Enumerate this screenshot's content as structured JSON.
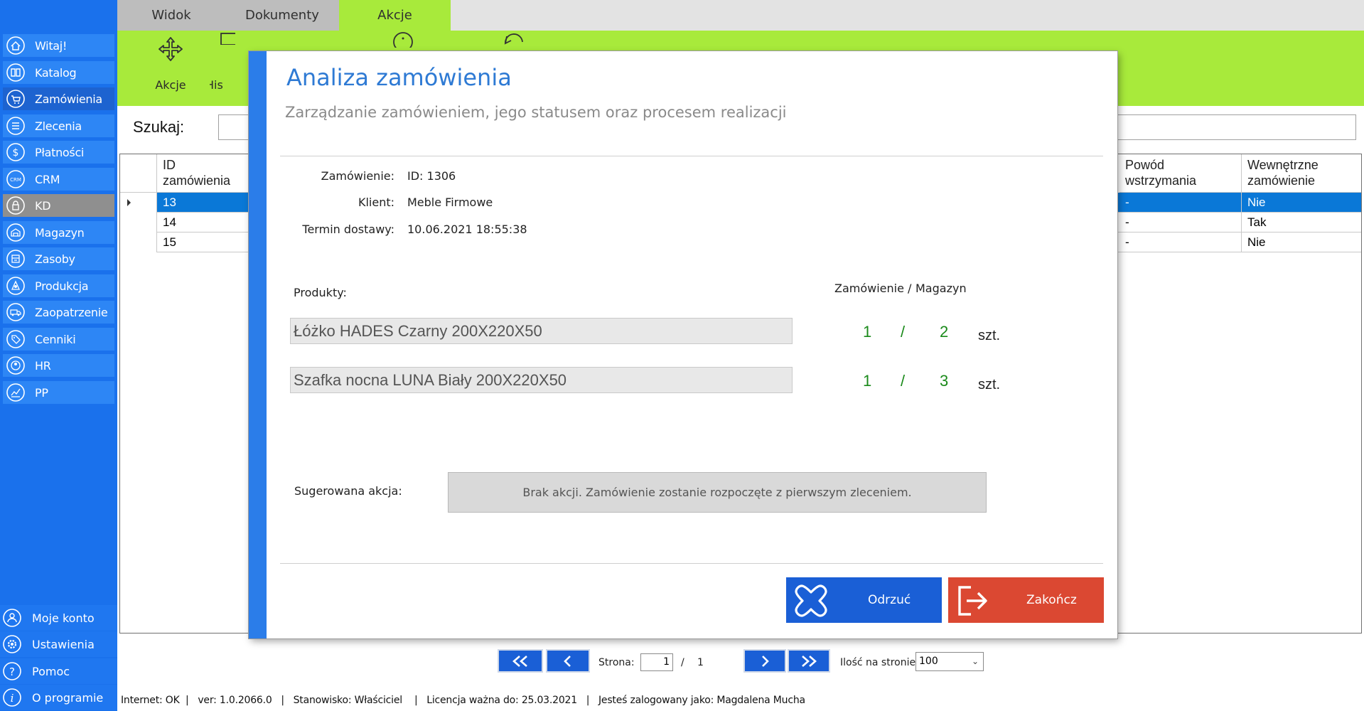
{
  "sidebar": {
    "items": [
      {
        "label": "Witaj!",
        "icon": "home-icon"
      },
      {
        "label": "Katalog",
        "icon": "book-icon"
      },
      {
        "label": "Zamówienia",
        "icon": "cart-icon"
      },
      {
        "label": "Zlecenia",
        "icon": "list-icon"
      },
      {
        "label": "Płatności",
        "icon": "dollar-icon"
      },
      {
        "label": "CRM",
        "icon": "crm-icon"
      },
      {
        "label": "KD",
        "icon": "lock-icon"
      },
      {
        "label": "Magazyn",
        "icon": "warehouse-icon"
      },
      {
        "label": "Zasoby",
        "icon": "resources-icon"
      },
      {
        "label": "Produkcja",
        "icon": "production-icon"
      },
      {
        "label": "Zaopatrzenie",
        "icon": "truck-icon"
      },
      {
        "label": "Cenniki",
        "icon": "tag-icon"
      },
      {
        "label": "HR",
        "icon": "hr-icon"
      },
      {
        "label": "PP",
        "icon": "pp-icon"
      }
    ],
    "bottom": [
      {
        "label": "Moje konto",
        "icon": "user-icon"
      },
      {
        "label": "Ustawienia",
        "icon": "gear-icon"
      },
      {
        "label": "Pomoc",
        "icon": "question-icon"
      },
      {
        "label": "O programie",
        "icon": "info-icon"
      }
    ]
  },
  "ribbon": {
    "tabs": [
      "Widok",
      "Dokumenty",
      "Akcje"
    ],
    "tools": [
      "Akcje",
      "His"
    ]
  },
  "search": {
    "label": "Szukaj:",
    "value": ""
  },
  "grid": {
    "headers": {
      "id": "ID\nzamówienia",
      "reason": "Powód\nwstrzymania",
      "internal": "Wewnętrzne\nzamówienie"
    },
    "rows": [
      {
        "id": "13",
        "reason": "-",
        "internal": "Nie"
      },
      {
        "id": "14",
        "reason": "-",
        "internal": "Tak"
      },
      {
        "id": "15",
        "reason": "-",
        "internal": "Nie"
      }
    ]
  },
  "pager": {
    "page_label": "Strona:",
    "page": "1",
    "separator": "/",
    "total": "1",
    "per_page_label": "Ilość na stronie:",
    "per_page": "100"
  },
  "status": {
    "text": "Internet: OK  |   ver: 1.0.2066.0   |   Stanowisko: Właściciel    |   Licencja ważna do: 25.03.2021   |   Jesteś zalogowany jako: Magdalena Mucha"
  },
  "modal": {
    "title": "Analiza zamówienia",
    "subtitle": "Zarządzanie zamówieniem, jego statusem oraz procesem realizacji",
    "order_label": "Zamówienie:",
    "order_value": "ID: 1306",
    "client_label": "Klient:",
    "client_value": "Meble Firmowe",
    "deadline_label": "Termin dostawy:",
    "deadline_value": "10.06.2021 18:55:38",
    "products_label": "Produkty:",
    "col_order": "Zamówienie /",
    "col_stock": "Magazyn",
    "products": [
      {
        "name": "Łóżko HADES Czarny 200X220X50",
        "ordered": "1",
        "sep": "/",
        "stock": "2",
        "unit": "szt."
      },
      {
        "name": "Szafka nocna LUNA Biały 200X220X50",
        "ordered": "1",
        "sep": "/",
        "stock": "3",
        "unit": "szt."
      }
    ],
    "suggest_label": "Sugerowana akcja:",
    "suggest_value": "Brak akcji. Zamówienie zostanie rozpoczęte z pierwszym zleceniem.",
    "reject_label": "Odrzuć",
    "finish_label": "Zakończ",
    "colors": {
      "reject": "#1a5fd6",
      "finish": "#db4832",
      "accent": "#2b7de9"
    }
  }
}
